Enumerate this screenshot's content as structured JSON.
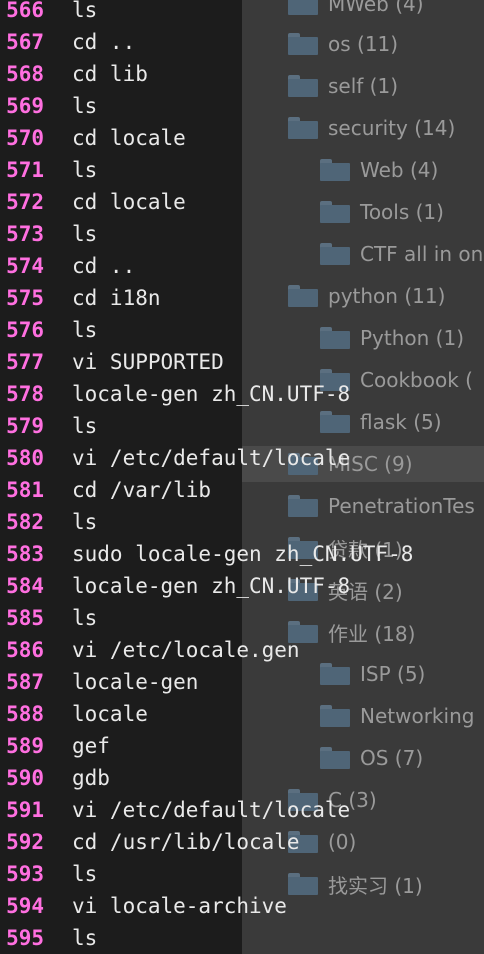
{
  "sidebar": {
    "items": [
      {
        "label": "MWeb (4)",
        "level": 0
      },
      {
        "label": "os (11)",
        "level": 0
      },
      {
        "label": "self (1)",
        "level": 0
      },
      {
        "label": "security (14)",
        "level": 0,
        "expanded": true
      },
      {
        "label": "Web (4)",
        "level": 1
      },
      {
        "label": "Tools (1)",
        "level": 1
      },
      {
        "label": "CTF all in one",
        "level": 1
      },
      {
        "label": "python (11)",
        "level": 0,
        "expanded": true
      },
      {
        "label": "Python (1)",
        "level": 1
      },
      {
        "label": "Cookbook (",
        "level": 1
      },
      {
        "label": "flask (5)",
        "level": 1
      },
      {
        "label": "MISC (9)",
        "level": 0
      },
      {
        "label": "PenetrationTes",
        "level": 0
      },
      {
        "label": "贷款 (1)",
        "level": 0
      },
      {
        "label": "英语 (2)",
        "level": 0
      },
      {
        "label": "作业 (18)",
        "level": 0,
        "expanded": true
      },
      {
        "label": "ISP (5)",
        "level": 1
      },
      {
        "label": "Networking",
        "level": 1
      },
      {
        "label": "OS (7)",
        "level": 1
      },
      {
        "label": "C (3)",
        "level": 0
      },
      {
        "label": "(0)",
        "level": 0
      },
      {
        "label": "找实习 (1)",
        "level": 0
      }
    ]
  },
  "terminal": {
    "lines": [
      {
        "no": "566",
        "cmd": "ls"
      },
      {
        "no": "567",
        "cmd": "cd .."
      },
      {
        "no": "568",
        "cmd": "cd lib"
      },
      {
        "no": "569",
        "cmd": "ls"
      },
      {
        "no": "570",
        "cmd": "cd locale"
      },
      {
        "no": "571",
        "cmd": "ls"
      },
      {
        "no": "572",
        "cmd": "cd locale"
      },
      {
        "no": "573",
        "cmd": "ls"
      },
      {
        "no": "574",
        "cmd": "cd .."
      },
      {
        "no": "575",
        "cmd": "cd i18n"
      },
      {
        "no": "576",
        "cmd": "ls"
      },
      {
        "no": "577",
        "cmd": "vi SUPPORTED"
      },
      {
        "no": "578",
        "cmd": "locale-gen zh_CN.UTF-8"
      },
      {
        "no": "579",
        "cmd": "ls"
      },
      {
        "no": "580",
        "cmd": "vi /etc/default/locale"
      },
      {
        "no": "581",
        "cmd": "cd /var/lib"
      },
      {
        "no": "582",
        "cmd": "ls"
      },
      {
        "no": "583",
        "cmd": "sudo locale-gen zh_CN.UTF-8"
      },
      {
        "no": "584",
        "cmd": "locale-gen zh_CN.UTF-8"
      },
      {
        "no": "585",
        "cmd": "ls"
      },
      {
        "no": "586",
        "cmd": "vi /etc/locale.gen"
      },
      {
        "no": "587",
        "cmd": "locale-gen"
      },
      {
        "no": "588",
        "cmd": "locale"
      },
      {
        "no": "589",
        "cmd": "gef"
      },
      {
        "no": "590",
        "cmd": "gdb"
      },
      {
        "no": "591",
        "cmd": "vi /etc/default/locale"
      },
      {
        "no": "592",
        "cmd": "cd /usr/lib/locale"
      },
      {
        "no": "593",
        "cmd": "ls"
      },
      {
        "no": "594",
        "cmd": "vi locale-archive"
      },
      {
        "no": "595",
        "cmd": "ls"
      }
    ]
  },
  "colors": {
    "line_number": "#ff6fe0",
    "command_text": "#e9e9e9",
    "sidebar_text": "#9a9a9a",
    "folder_icon": "#4f6577"
  }
}
